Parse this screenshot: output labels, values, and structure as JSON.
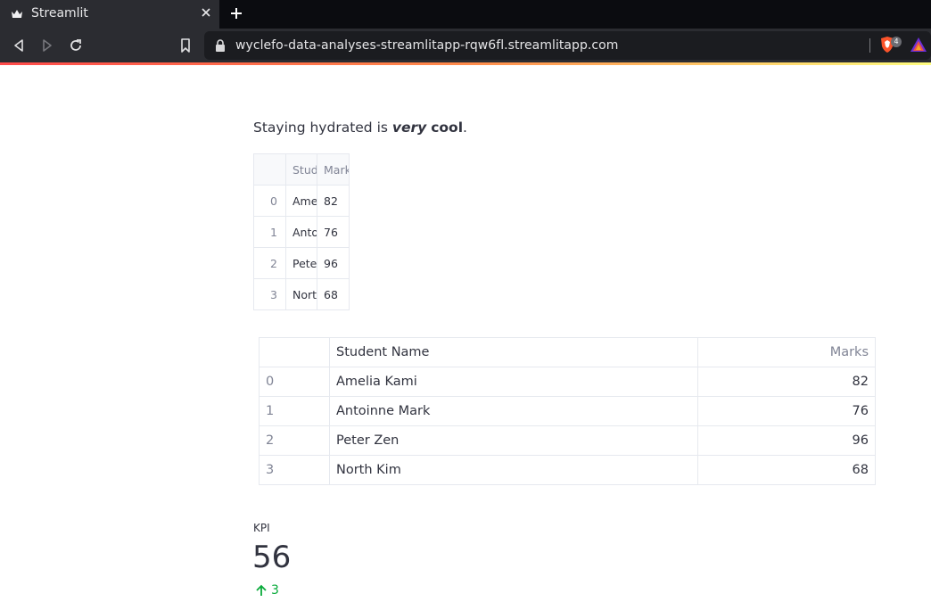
{
  "browser": {
    "tab_title": "Streamlit",
    "url": "wyclefo-data-analyses-streamlitapp-rqw6fl.streamlitapp.com",
    "shield_count": "4"
  },
  "page": {
    "markdown": {
      "prefix": "Staying hydrated is ",
      "italic": "very",
      "space": " ",
      "bold": "cool",
      "suffix": "."
    },
    "dataframe": {
      "columns": [
        "Stud",
        "Mark"
      ],
      "rows": [
        {
          "index": "0",
          "name": "Ame",
          "marks": "82"
        },
        {
          "index": "1",
          "name": "Anto",
          "marks": "76"
        },
        {
          "index": "2",
          "name": "Pete",
          "marks": "96"
        },
        {
          "index": "3",
          "name": "Nort",
          "marks": "68"
        }
      ]
    },
    "table": {
      "columns": [
        "Student Name",
        "Marks"
      ],
      "rows": [
        {
          "index": "0",
          "name": "Amelia Kami",
          "marks": "82"
        },
        {
          "index": "1",
          "name": "Antoinne Mark",
          "marks": "76"
        },
        {
          "index": "2",
          "name": "Peter Zen",
          "marks": "96"
        },
        {
          "index": "3",
          "name": "North Kim",
          "marks": "68"
        }
      ]
    },
    "metric": {
      "label": "KPI",
      "value": "56",
      "delta": "3",
      "delta_color": "#09ab3b"
    }
  }
}
